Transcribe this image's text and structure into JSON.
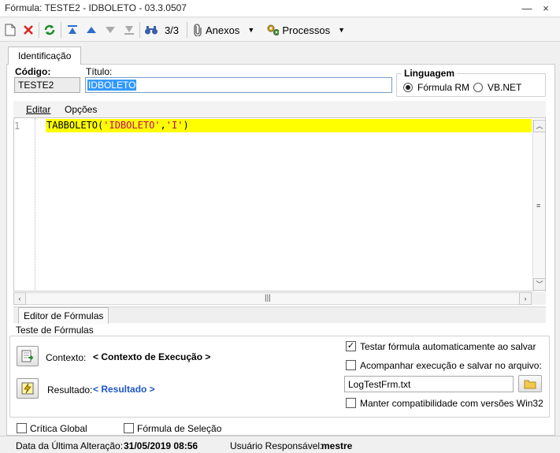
{
  "window": {
    "title": "Fórmula: TESTE2 - IDBOLETO - 03.3.0507",
    "minimize_label": "—",
    "close_label": "×"
  },
  "toolbar": {
    "record_counter": "3/3",
    "anexos_label": "Anexos",
    "processos_label": "Processos"
  },
  "tabs": {
    "identificacao": "Identificação",
    "editor_formulas": "Editor de Fórmulas"
  },
  "fields": {
    "codigo_label": "Código:",
    "codigo_value": "TESTE2",
    "titulo_label": "Título:",
    "titulo_value": "IDBOLETO"
  },
  "linguagem": {
    "title": "Linguagem",
    "options": [
      "Fórmula RM",
      "VB.NET"
    ],
    "selected": "Fórmula RM"
  },
  "editor": {
    "menu": [
      "Editar",
      "Opções"
    ],
    "line_number": "1",
    "code_func": "TABBOLETO",
    "code_open": "(",
    "code_arg1": "'IDBOLETO'",
    "code_comma": ",",
    "code_arg2": "'I'",
    "code_close": ")"
  },
  "teste": {
    "title": "Teste de Fórmulas",
    "contexto_label": "Contexto:",
    "contexto_value": "< Contexto de Execução >",
    "resultado_label": "Resultado:",
    "resultado_value": "< Resultado >",
    "testar_auto_label": "Testar fórmula automaticamente ao salvar",
    "testar_auto_checked": true,
    "acompanhar_label": "Acompanhar execução e salvar no arquivo:",
    "acompanhar_checked": false,
    "log_file": "LogTestFrm.txt",
    "manter_label": "Manter compatibilidade com versões Win32",
    "manter_checked": false
  },
  "footer": {
    "critica_global_label": "Crítica Global",
    "formula_selecao_label": "Fórmula de Seleção",
    "data_label": "Data da Última Alteração:",
    "data_value": "31/05/2019 08:56",
    "usuario_label": "Usuário Responsável:",
    "usuario_value": "mestre"
  },
  "colors": {
    "highlight_line": "#ffff00",
    "string_color": "#c3006e",
    "link_blue": "#1e56c8",
    "selection_blue": "#3399ff"
  }
}
